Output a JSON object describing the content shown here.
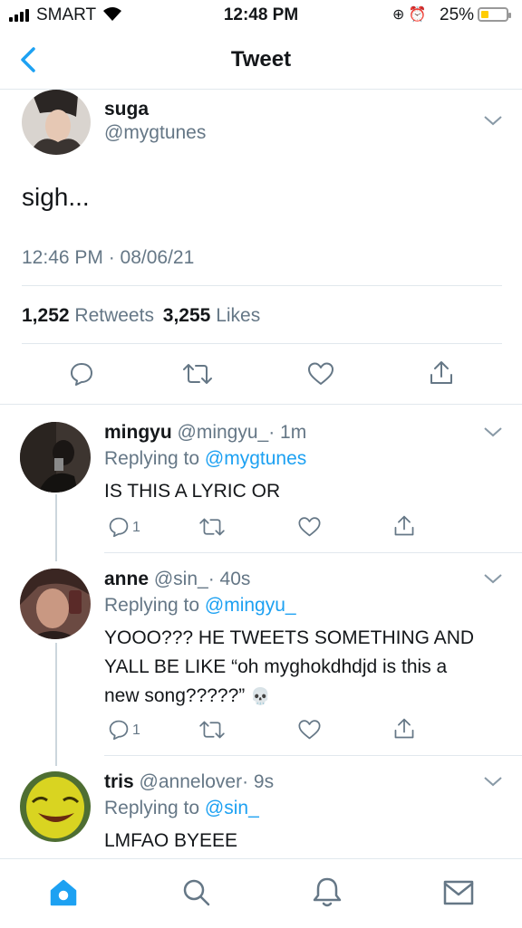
{
  "status_bar": {
    "carrier": "SMART",
    "time": "12:48 PM",
    "battery_percent": "25%",
    "battery_level": 0.25
  },
  "nav": {
    "title": "Tweet"
  },
  "tweet": {
    "name": "suga",
    "handle": "@mygtunes",
    "text": "sigh...",
    "timestamp": "12:46 PM · 08/06/21",
    "retweets_count": "1,252",
    "retweets_label": "Retweets",
    "likes_count": "3,255",
    "likes_label": "Likes"
  },
  "replies": [
    {
      "name": "mingyu",
      "handle": "@mingyu_",
      "time": "· 1m",
      "replying_label": "Replying to",
      "replying_to": "@mygtunes",
      "text_lines": [
        "IS THIS A LYRIC OR"
      ],
      "reply_count": "1"
    },
    {
      "name": "anne",
      "handle": "@sin_",
      "time": "· 40s",
      "replying_label": "Replying to",
      "replying_to": "@mingyu_",
      "text_lines": [
        "YOOO??? HE TWEETS SOMETHING AND",
        "YALL BE LIKE “oh myghokdhdjd is this a",
        "new song?????”"
      ],
      "emoji": "💀",
      "reply_count": "1"
    },
    {
      "name": "tris",
      "handle": "@annelover",
      "time": "· 9s",
      "replying_label": "Replying to",
      "replying_to": "@sin_",
      "text_lines": [
        "LMFAO BYEEE"
      ]
    }
  ],
  "tab_bar": {
    "items": [
      "home-icon",
      "search-icon",
      "notifications-icon",
      "messages-icon"
    ],
    "active": "home-icon"
  },
  "colors": {
    "accent": "#1da1f2",
    "secondary_text": "#657786",
    "divider": "#e1e8ed"
  }
}
